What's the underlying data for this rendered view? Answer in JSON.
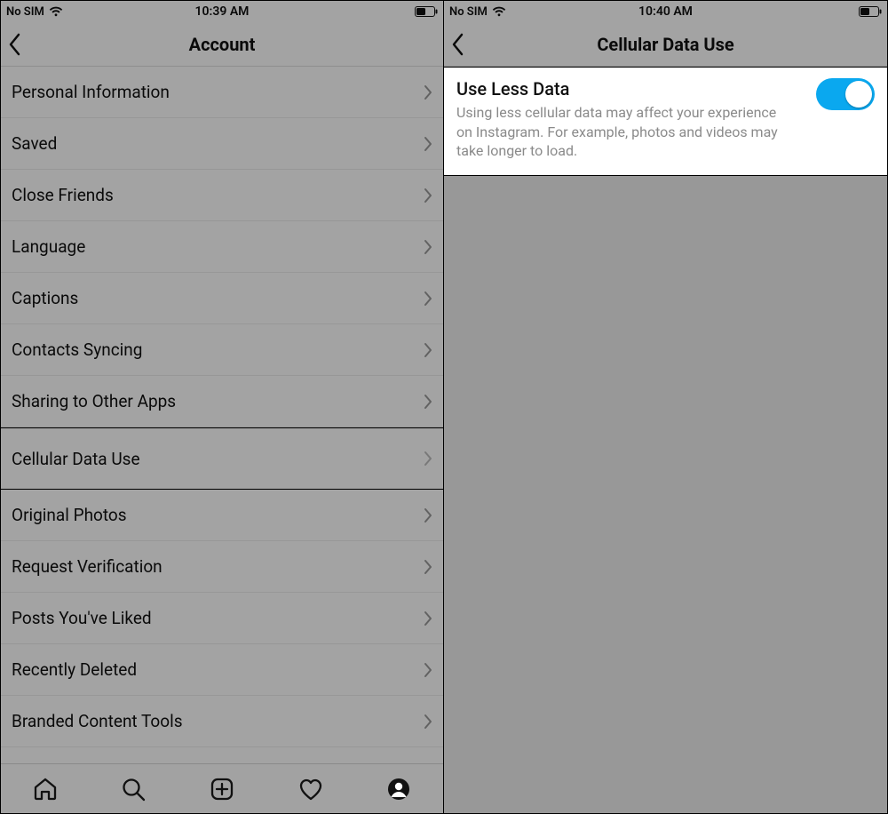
{
  "left": {
    "status": {
      "carrier": "No SIM",
      "time": "10:39 AM"
    },
    "nav": {
      "title": "Account"
    },
    "items": [
      {
        "label": "Personal Information"
      },
      {
        "label": "Saved"
      },
      {
        "label": "Close Friends"
      },
      {
        "label": "Language"
      },
      {
        "label": "Captions"
      },
      {
        "label": "Contacts Syncing"
      },
      {
        "label": "Sharing to Other Apps"
      },
      {
        "label": "Cellular Data Use",
        "highlight": true
      },
      {
        "label": "Original Photos"
      },
      {
        "label": "Request Verification"
      },
      {
        "label": "Posts You've Liked"
      },
      {
        "label": "Recently Deleted"
      },
      {
        "label": "Branded Content Tools"
      }
    ],
    "tabs": [
      "home",
      "search",
      "create",
      "activity",
      "profile"
    ]
  },
  "right": {
    "status": {
      "carrier": "No SIM",
      "time": "10:40 AM"
    },
    "nav": {
      "title": "Cellular Data Use"
    },
    "detail": {
      "title": "Use Less Data",
      "description": "Using less cellular data may affect your experience on Instagram. For example, photos and videos may take longer to load.",
      "toggle": true
    }
  }
}
